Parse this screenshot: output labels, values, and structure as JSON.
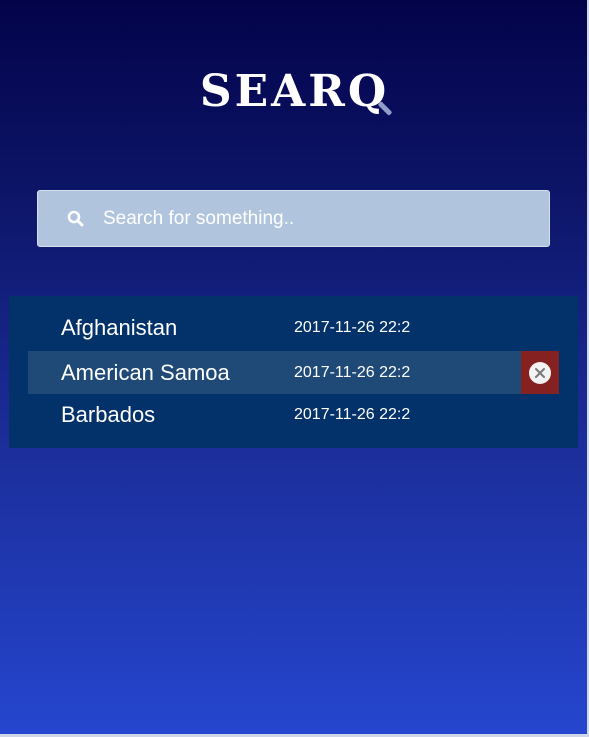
{
  "logo": {
    "text": "SEARQ"
  },
  "search": {
    "placeholder": "Search for something..",
    "value": ""
  },
  "results": [
    {
      "name": "Afghanistan",
      "date": "2017-11-26 22:2",
      "hovered": false
    },
    {
      "name": "American Samoa",
      "date": "2017-11-26 22:2",
      "hovered": true
    },
    {
      "name": "Barbados",
      "date": "2017-11-26 22:2",
      "hovered": false
    }
  ],
  "icons": {
    "search": "search-icon",
    "remove": "close-circle-icon"
  },
  "colors": {
    "results_bg": "#03326a",
    "row_hover": "#1f4a78",
    "remove_bg": "#862121",
    "search_bg": "#b0c4de"
  }
}
